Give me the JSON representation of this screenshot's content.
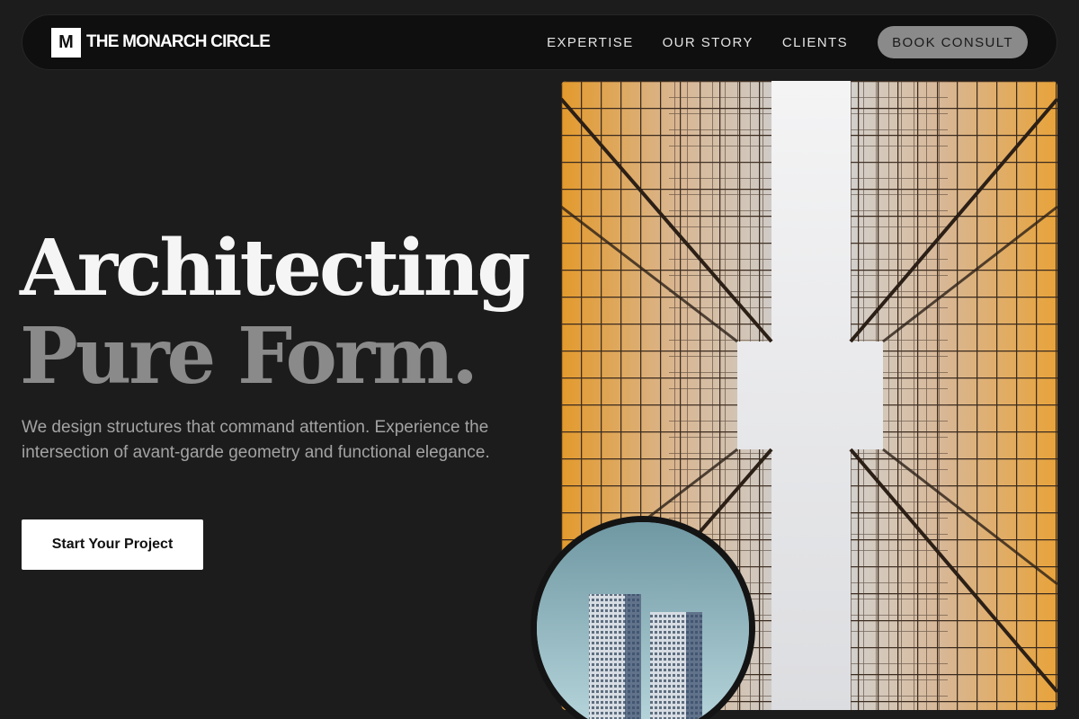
{
  "brand": {
    "mark": "M",
    "name": "THE MONARCH CIRCLE"
  },
  "nav": {
    "links": [
      "EXPERTISE",
      "OUR STORY",
      "CLIENTS"
    ],
    "cta": "BOOK CONSULT"
  },
  "hero": {
    "headline_line1": "Architecting",
    "headline_line2": "Pure Form.",
    "subtext": "We design structures that command attention. Experience the intersection of avant-garde geometry and functional elegance.",
    "cta": "Start Your Project"
  },
  "images": {
    "main": "glass-skyscrapers-upward-view",
    "inset": "twin-towers-sky"
  },
  "colors": {
    "background": "#1c1c1c",
    "accent_gray": "#8a8a8a",
    "glass_amber": "#e8a33a"
  }
}
